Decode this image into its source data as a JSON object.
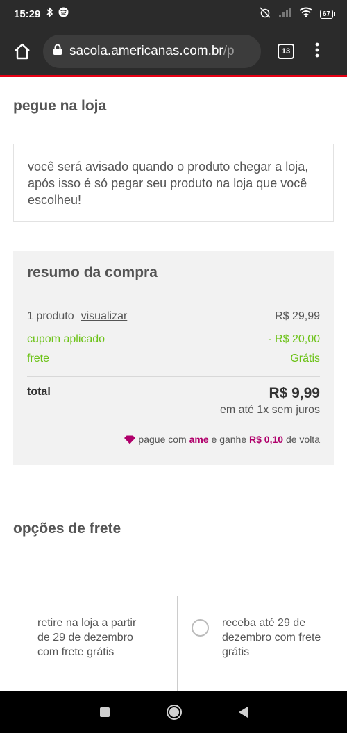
{
  "status_bar": {
    "time": "15:29",
    "battery": "67"
  },
  "browser": {
    "url_main": "sacola.americanas.com.br",
    "url_rest": "/p",
    "tab_count": "13"
  },
  "pickup": {
    "title": "pegue na loja",
    "notice": "você será avisado quando o produto chegar a loja, após isso é só pegar seu produto na loja que você escolheu!"
  },
  "summary": {
    "title": "resumo da compra",
    "product_count": "1 produto",
    "view_link": "visualizar",
    "product_price": "R$ 29,99",
    "coupon_label": "cupom aplicado",
    "coupon_value": "- R$ 20,00",
    "shipping_label": "frete",
    "shipping_value": "Grátis",
    "total_label": "total",
    "total_value": "R$ 9,99",
    "installments": "em até 1x sem juros",
    "ame_prefix": "pague com",
    "ame_brand": "ame",
    "ame_middle": "e ganhe",
    "ame_cashback": "R$ 0,10",
    "ame_suffix": "de volta"
  },
  "shipping_options": {
    "title": "opções de frete",
    "option_1": [
      "retire na loja a partir",
      "de 29 de dezembro",
      "com frete grátis"
    ],
    "option_2": [
      "receba até 29 de",
      "dezembro com frete",
      "grátis"
    ]
  },
  "colors": {
    "accent": "#e60014",
    "green": "#6cc217",
    "ame": "#b0006b"
  }
}
